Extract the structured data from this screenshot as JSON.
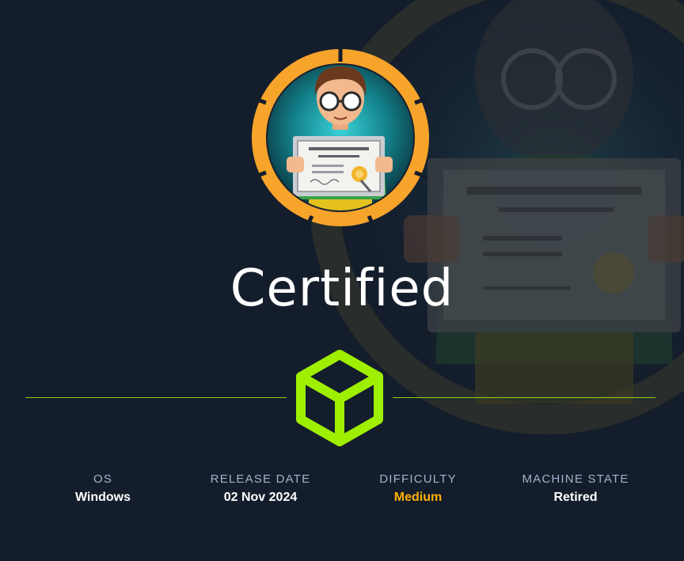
{
  "machine": {
    "name": "Certified"
  },
  "stats": [
    {
      "label": "OS",
      "value": "Windows"
    },
    {
      "label": "RELEASE DATE",
      "value": "02 Nov 2024"
    },
    {
      "label": "DIFFICULTY",
      "value": "Medium"
    },
    {
      "label": "MACHINE STATE",
      "value": "Retired"
    }
  ],
  "colors": {
    "background": "#141d2b",
    "accent_green": "#9fef00",
    "difficulty_medium": "#ffaf00",
    "label_gray": "#a4b1cd",
    "avatar_ring": "#f7a42b"
  },
  "icons": {
    "logo": "cube-icon",
    "avatar": "certificate-holder-avatar"
  }
}
